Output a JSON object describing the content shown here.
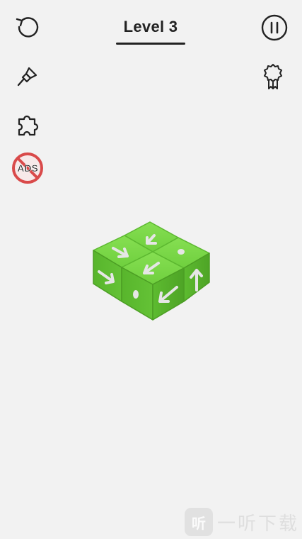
{
  "header": {
    "level_title": "Level 3"
  },
  "left_toolbar": [
    {
      "icon": "restart-icon"
    },
    {
      "icon": "paint-brush-icon"
    },
    {
      "icon": "puzzle-piece-icon"
    },
    {
      "icon": "no-ads-icon",
      "label": "ADS"
    }
  ],
  "right_toolbar": [
    {
      "icon": "pause-icon"
    },
    {
      "icon": "ribbon-badge-icon"
    }
  ],
  "board": {
    "cube_color": "#6fcf3e",
    "cubes": [
      {
        "position": "back",
        "arrow": "down-left"
      },
      {
        "position": "right",
        "top_face": "dot",
        "front_face": "up"
      },
      {
        "position": "left",
        "top_face": "down-right",
        "side_face": "right"
      },
      {
        "position": "front",
        "top_face": "down-left",
        "left_face": "dot",
        "right_face": "down-left"
      }
    ]
  },
  "watermark": {
    "badge": "听",
    "text": "一听下载"
  },
  "colors": {
    "background": "#f2f2f2",
    "icon": "#222222",
    "cube": "#6fcf3e"
  }
}
